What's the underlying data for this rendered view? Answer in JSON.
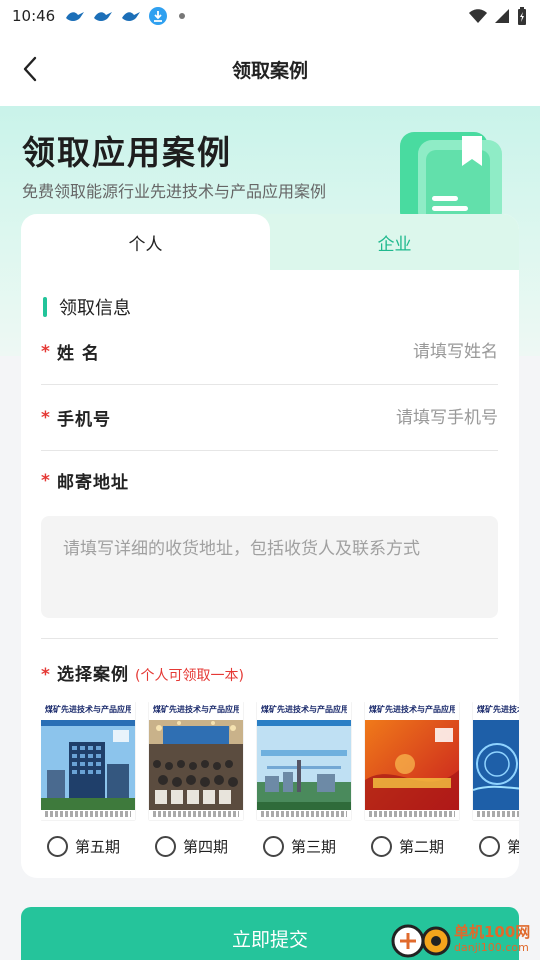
{
  "status_bar": {
    "time": "10:46",
    "icons": [
      "bird-icon",
      "bird-icon",
      "bird-icon",
      "download-icon",
      "dot-icon"
    ],
    "right_icons": [
      "wifi-icon",
      "signal-icon",
      "battery-icon"
    ]
  },
  "nav": {
    "title": "领取案例",
    "back_icon": "chevron-left-icon"
  },
  "hero": {
    "title": "领取应用案例",
    "subtitle": "免费领取能源行业先进技术与产品应用案例",
    "icon": "book-icon"
  },
  "tabs": [
    {
      "label": "个人",
      "active": true
    },
    {
      "label": "企业",
      "active": false
    }
  ],
  "section": {
    "title": "领取信息"
  },
  "form": {
    "required_mark": "*",
    "name": {
      "label": "姓 名",
      "placeholder": "请填写姓名",
      "value": ""
    },
    "phone": {
      "label": "手机号",
      "placeholder": "请填写手机号",
      "value": ""
    },
    "address": {
      "label": "邮寄地址",
      "placeholder": "请填写详细的收货地址，包括收货人及联系方式",
      "value": ""
    }
  },
  "cases": {
    "label": "选择案例",
    "note": "(个人可领取一本)",
    "items": [
      {
        "cover_title": "煤矿先进技术与产品应用案例",
        "label": "第五期",
        "selected": false
      },
      {
        "cover_title": "煤矿先进技术与产品应用案例",
        "label": "第四期",
        "selected": false
      },
      {
        "cover_title": "煤矿先进技术与产品应用案例",
        "label": "第三期",
        "selected": false
      },
      {
        "cover_title": "煤矿先进技术与产品应用案例",
        "label": "第二期",
        "selected": false
      },
      {
        "cover_title": "煤矿先进技术与产品应用案例",
        "label": "第一期",
        "selected": false
      }
    ]
  },
  "submit": {
    "label": "立即提交"
  },
  "watermark": {
    "main": "单机100网",
    "sub": "danji100.com"
  },
  "colors": {
    "accent": "#25c49b",
    "tab_inactive_bg": "#dcf7ec",
    "required": "#e53935"
  }
}
